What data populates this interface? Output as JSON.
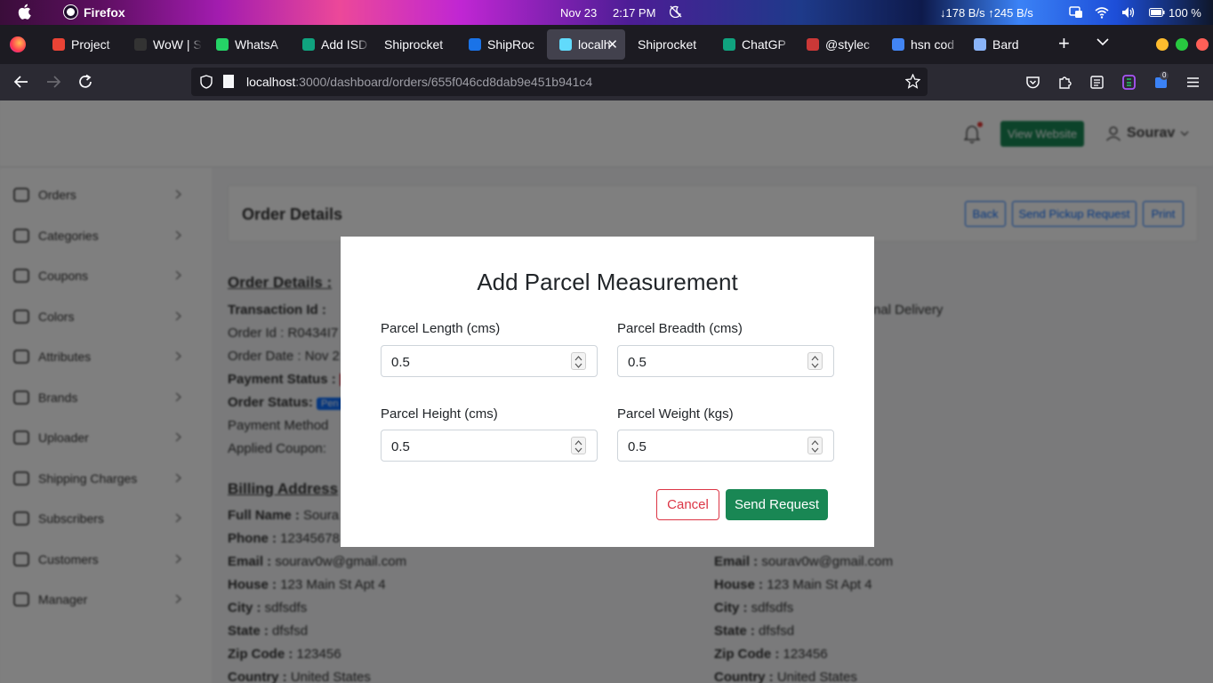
{
  "menubar": {
    "app_name": "Firefox",
    "date": "Nov 23",
    "time": "2:17 PM",
    "netspeed": "↓178 B/s ↑245 B/s",
    "battery": "100 %"
  },
  "tabs": [
    {
      "label": "Project",
      "favicon": "gmail-icon",
      "color": "#ea4335"
    },
    {
      "label": "WoW | S",
      "favicon": "wow-icon",
      "color": "#333333"
    },
    {
      "label": "WhatsA",
      "favicon": "whatsapp-icon",
      "color": "#25d366"
    },
    {
      "label": "Add ISD",
      "favicon": "chatgpt-icon",
      "color": "#10a37f"
    },
    {
      "label": "Shiprocket",
      "favicon": "",
      "color": ""
    },
    {
      "label": "ShipRoc",
      "favicon": "cp-icon",
      "color": "#1a73e8"
    },
    {
      "label": "localh",
      "favicon": "react-icon",
      "color": "#61dafb"
    },
    {
      "label": "Shiprocket",
      "favicon": "",
      "color": ""
    },
    {
      "label": "ChatGP",
      "favicon": "chatgpt-icon",
      "color": "#10a37f"
    },
    {
      "label": "@stylec",
      "favicon": "npm-icon",
      "color": "#cb3837"
    },
    {
      "label": "hsn cod",
      "favicon": "google-icon",
      "color": "#4285f4"
    },
    {
      "label": "Bard",
      "favicon": "bard-icon",
      "color": "#8ab4f8"
    }
  ],
  "urlbar": {
    "host": "localhost",
    "path": ":3000/dashboard/orders/655f046cd8dab9e451b941c4"
  },
  "toolbar": {
    "extension_badge": "0"
  },
  "topbar": {
    "view_website": "View Website",
    "username": "Sourav"
  },
  "sidebar": {
    "items": [
      {
        "label": "Orders",
        "icon": "orders-icon"
      },
      {
        "label": "Categories",
        "icon": "categories-icon"
      },
      {
        "label": "Coupons",
        "icon": "coupons-icon"
      },
      {
        "label": "Colors",
        "icon": "palette-icon"
      },
      {
        "label": "Attributes",
        "icon": "attributes-icon"
      },
      {
        "label": "Brands",
        "icon": "star-icon"
      },
      {
        "label": "Uploader",
        "icon": "box-icon"
      },
      {
        "label": "Shipping Charges",
        "icon": "truck-icon"
      },
      {
        "label": "Subscribers",
        "icon": "subscribers-icon"
      },
      {
        "label": "Customers",
        "icon": "users-icon"
      },
      {
        "label": "Manager",
        "icon": "users-icon"
      }
    ]
  },
  "order_header": {
    "title": "Order Details",
    "back": "Back",
    "pickup": "Send Pickup Request",
    "print": "Print"
  },
  "details": {
    "heading": "Order Details :",
    "transaction_label": "Transaction Id :",
    "order_id": "Order Id : R0434I7",
    "order_date": "Order Date : Nov 2",
    "payment_status": "Payment Status :",
    "order_status": "Order Status:",
    "order_status_badge": "Pen",
    "payment_method": "Payment Method",
    "applied_coupon": "Applied Coupon:",
    "delivery_fragment": "nal Delivery",
    "billing_heading": "Billing Address",
    "billing": {
      "full_name_label": "Full Name :",
      "full_name": "Soura",
      "phone_label": "Phone :",
      "phone": "12345678",
      "email_label": "Email :",
      "email": "sourav0w@gmail.com",
      "house_label": "House :",
      "house": "123 Main St Apt 4",
      "city_label": "City :",
      "city": "sdfsdfs",
      "state_label": "State :",
      "state": "dfsfsd",
      "zip_label": "Zip Code :",
      "zip": "123456",
      "country_label": "Country :",
      "country": "United States"
    },
    "shipping": {
      "email_label": "Email :",
      "email": "sourav0w@gmail.com",
      "house_label": "House :",
      "house": "123 Main St Apt 4",
      "city_label": "City :",
      "city": "sdfsdfs",
      "state_label": "State :",
      "state": "dfsfsd",
      "zip_label": "Zip Code :",
      "zip": "123456",
      "country_label": "Country :",
      "country": "United States"
    }
  },
  "modal": {
    "title": "Add Parcel Measurement",
    "fields": {
      "length": {
        "label": "Parcel Length (cms)",
        "value": "0.5"
      },
      "breadth": {
        "label": "Parcel Breadth (cms)",
        "value": "0.5"
      },
      "height": {
        "label": "Parcel Height (cms)",
        "value": "0.5"
      },
      "weight": {
        "label": "Parcel Weight (kgs)",
        "value": "0.5"
      }
    },
    "cancel": "Cancel",
    "send": "Send Request"
  },
  "colors": {
    "primary": "#0d6efd",
    "success": "#198754",
    "danger": "#dc3545"
  }
}
